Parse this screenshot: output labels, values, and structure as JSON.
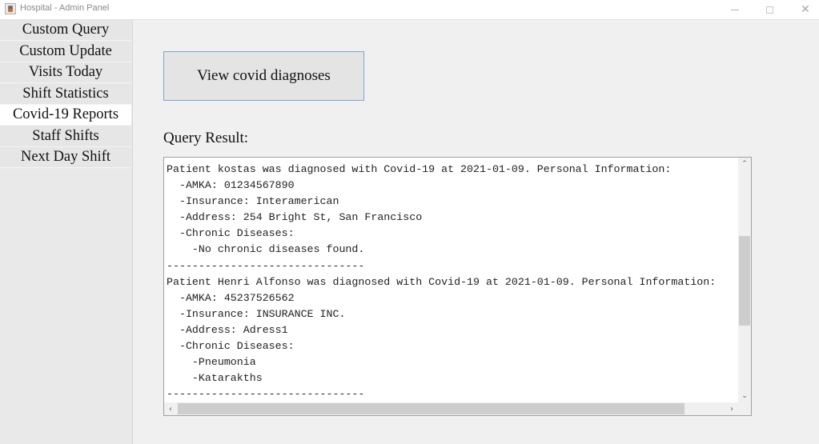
{
  "window": {
    "title": "Hospital - Admin Panel",
    "icon": "java-cup-icon",
    "controls": {
      "minimize": "minimize-icon",
      "maximize": "maximize-icon",
      "close": "close-icon"
    }
  },
  "sidebar": {
    "active_index": 4,
    "items": [
      {
        "label": "Custom Query"
      },
      {
        "label": "Custom Update"
      },
      {
        "label": "Visits Today"
      },
      {
        "label": "Shift Statistics"
      },
      {
        "label": "Covid-19 Reports"
      },
      {
        "label": "Staff Shifts"
      },
      {
        "label": "Next Day Shift"
      }
    ]
  },
  "main": {
    "action_button_label": "View covid diagnoses",
    "result_label": "Query Result:",
    "result_lines": [
      "Patient kostas was diagnosed with Covid-19 at 2021-01-09. Personal Information:",
      "  -AMKA: 01234567890",
      "  -Insurance: Interamerican",
      "  -Address: 254 Bright St, San Francisco",
      "  -Chronic Diseases:",
      "    -No chronic diseases found.",
      "-------------------------------",
      "Patient Henri Alfonso was diagnosed with Covid-19 at 2021-01-09. Personal Information:",
      "  -AMKA: 45237526562",
      "  -Insurance: INSURANCE INC.",
      "  -Address: Adress1",
      "  -Chronic Diseases:",
      "    -Pneumonia",
      "    -Katarakths",
      "-------------------------------"
    ]
  },
  "colors": {
    "button_border": "#7aa7d4",
    "active_nav_bg": "#ffffff"
  }
}
